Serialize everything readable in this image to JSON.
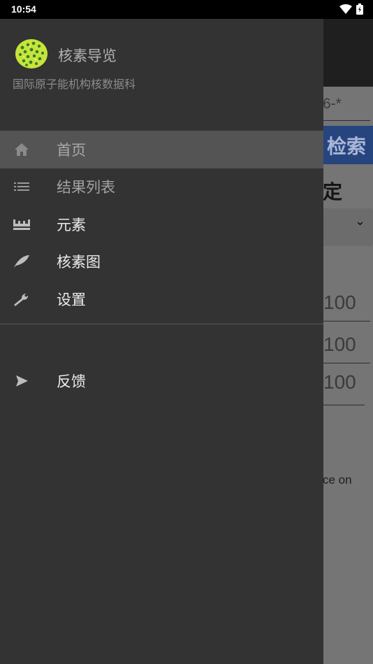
{
  "status_bar": {
    "time": "10:54"
  },
  "drawer": {
    "app_title": "核素导览",
    "app_subtitle": "国际原子能机构核数据科",
    "menu_items": [
      {
        "label": "首页",
        "icon": "home-icon"
      },
      {
        "label": "结果列表",
        "icon": "list-icon"
      },
      {
        "label": "元素",
        "icon": "crown-icon"
      },
      {
        "label": "核素图",
        "icon": "feather-icon"
      },
      {
        "label": "设置",
        "icon": "wrench-icon"
      }
    ],
    "feedback_label": "反馈"
  },
  "background": {
    "field_hint": "6-*",
    "search_button": "检索",
    "section_fragment": "定",
    "values": [
      "100",
      "100",
      "100"
    ],
    "text_fragment": "ce on"
  },
  "colors": {
    "drawer_bg": "#333333",
    "active_item_bg": "#545454",
    "search_button_bg": "#26457f"
  }
}
